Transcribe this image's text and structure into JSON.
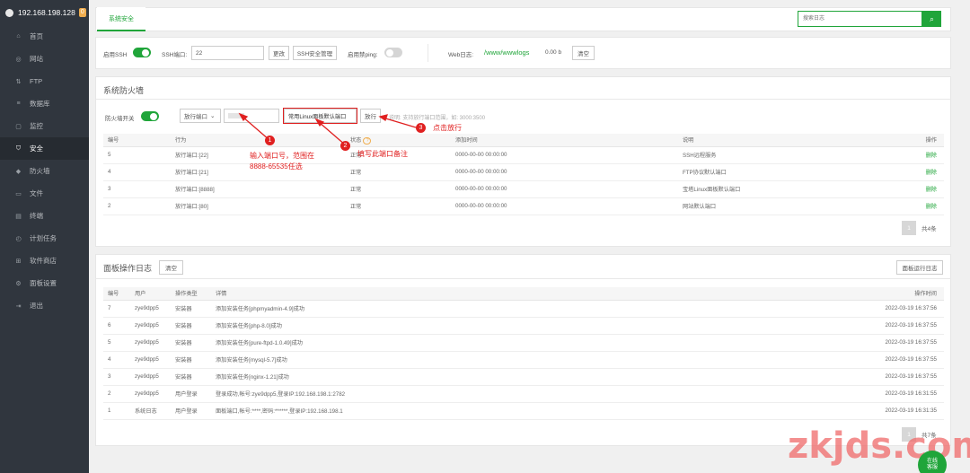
{
  "sidebar": {
    "host": "192.168.198.128",
    "badge": "0",
    "items": [
      {
        "label": "首页",
        "icon": "home-icon",
        "glyph": "⌂"
      },
      {
        "label": "网站",
        "icon": "globe-icon",
        "glyph": "◎"
      },
      {
        "label": "FTP",
        "icon": "ftp-icon",
        "glyph": "⇅"
      },
      {
        "label": "数据库",
        "icon": "database-icon",
        "glyph": "≡"
      },
      {
        "label": "监控",
        "icon": "monitor-icon",
        "glyph": "▢"
      },
      {
        "label": "安全",
        "icon": "shield-icon",
        "glyph": "⛉"
      },
      {
        "label": "防火墙",
        "icon": "firewall-icon",
        "glyph": "◆"
      },
      {
        "label": "文件",
        "icon": "folder-icon",
        "glyph": "▭"
      },
      {
        "label": "终端",
        "icon": "terminal-icon",
        "glyph": "▤"
      },
      {
        "label": "计划任务",
        "icon": "clock-icon",
        "glyph": "◴"
      },
      {
        "label": "软件商店",
        "icon": "grid-icon",
        "glyph": "⊞"
      },
      {
        "label": "面板设置",
        "icon": "settings-icon",
        "glyph": "⚙"
      },
      {
        "label": "退出",
        "icon": "logout-icon",
        "glyph": "⇥"
      }
    ],
    "active_index": 5
  },
  "topbar": {
    "tab": "系统安全",
    "search_placeholder": "搜索日志",
    "search_icon": "search-icon"
  },
  "ssh_bar": {
    "ssh_label": "启用SSH",
    "port_label": "SSH端口:",
    "port_value": "22",
    "change_btn": "更改",
    "ssh_mgr_btn": "SSH安全管理",
    "ping_label": "启用禁ping:",
    "weblog_label": "Web日志:",
    "weblog_path": "/www/wwwlogs",
    "weblog_size": "0.00 b",
    "clear_btn": "清空"
  },
  "firewall": {
    "title": "系统防火墙",
    "switch_label": "防火墙开关",
    "select_value": "放行端口",
    "port_input": "",
    "remark_input": "常用Linux面板默认端口",
    "release_btn": "放行",
    "hint": "说明: 支持放行端口范围，如: 3000:3500",
    "columns": [
      "编号",
      "行为",
      "状态",
      "添加时间",
      "说明",
      "操作"
    ],
    "rows": [
      {
        "id": "5",
        "action": "放行端口:[22]",
        "status": "正常",
        "time": "0000-00-00 00:00:00",
        "note": "SSH远程服务",
        "op": "删除"
      },
      {
        "id": "4",
        "action": "放行端口:[21]",
        "status": "正常",
        "time": "0000-00-00 00:00:00",
        "note": "FTP协议默认端口",
        "op": "删除"
      },
      {
        "id": "3",
        "action": "放行端口:[8888]",
        "status": "正常",
        "time": "0000-00-00 00:00:00",
        "note": "宝塔Linux面板默认端口",
        "op": "删除"
      },
      {
        "id": "2",
        "action": "放行端口:[80]",
        "status": "正常",
        "time": "0000-00-00 00:00:00",
        "note": "网站默认端口",
        "op": "删除"
      }
    ],
    "pager_page": "1",
    "pager_total": "共4条"
  },
  "annotations": {
    "n1": "1",
    "n2": "2",
    "n3": "3",
    "a1_line1": "输入端口号，范围在",
    "a1_line2": "8888-65535任选",
    "a2": "填写此端口备注",
    "a3": "点击放行"
  },
  "logs": {
    "title": "面板操作日志",
    "clear_btn": "清空",
    "run_log_btn": "面板运行日志",
    "columns": [
      "编号",
      "用户",
      "操作类型",
      "详情",
      "操作时间"
    ],
    "rows": [
      {
        "id": "7",
        "user": "zye9dpp5",
        "type": "安装器",
        "detail": "添加安装任务[phpmyadmin-4.9]成功",
        "time": "2022-03-19 16:37:56"
      },
      {
        "id": "6",
        "user": "zye9dpp5",
        "type": "安装器",
        "detail": "添加安装任务[php-8.0]成功",
        "time": "2022-03-19 16:37:55"
      },
      {
        "id": "5",
        "user": "zye9dpp5",
        "type": "安装器",
        "detail": "添加安装任务[pure-ftpd-1.0.49]成功",
        "time": "2022-03-19 16:37:55"
      },
      {
        "id": "4",
        "user": "zye9dpp5",
        "type": "安装器",
        "detail": "添加安装任务[mysql-5.7]成功",
        "time": "2022-03-19 16:37:55"
      },
      {
        "id": "3",
        "user": "zye9dpp5",
        "type": "安装器",
        "detail": "添加安装任务[nginx-1.21]成功",
        "time": "2022-03-19 16:37:55"
      },
      {
        "id": "2",
        "user": "zye9dpp5",
        "type": "用户登录",
        "detail": "登录成功,帐号:zye9dpp5,登录IP:192.168.198.1:2782",
        "time": "2022-03-19 16:31:55"
      },
      {
        "id": "1",
        "user": "系统日志",
        "type": "用户登录",
        "detail": "面板端口,帐号:****,密码:******,登录IP:192.168.198.1",
        "time": "2022-03-19 16:31:35"
      }
    ],
    "pager_page": "1",
    "pager_total": "共7条"
  },
  "watermark": "zkjds.com",
  "online": {
    "line1": "在线",
    "line2": "客服"
  },
  "colors": {
    "accent": "#20a53a",
    "sidebar": "#30363e",
    "annotation": "#e02020"
  }
}
